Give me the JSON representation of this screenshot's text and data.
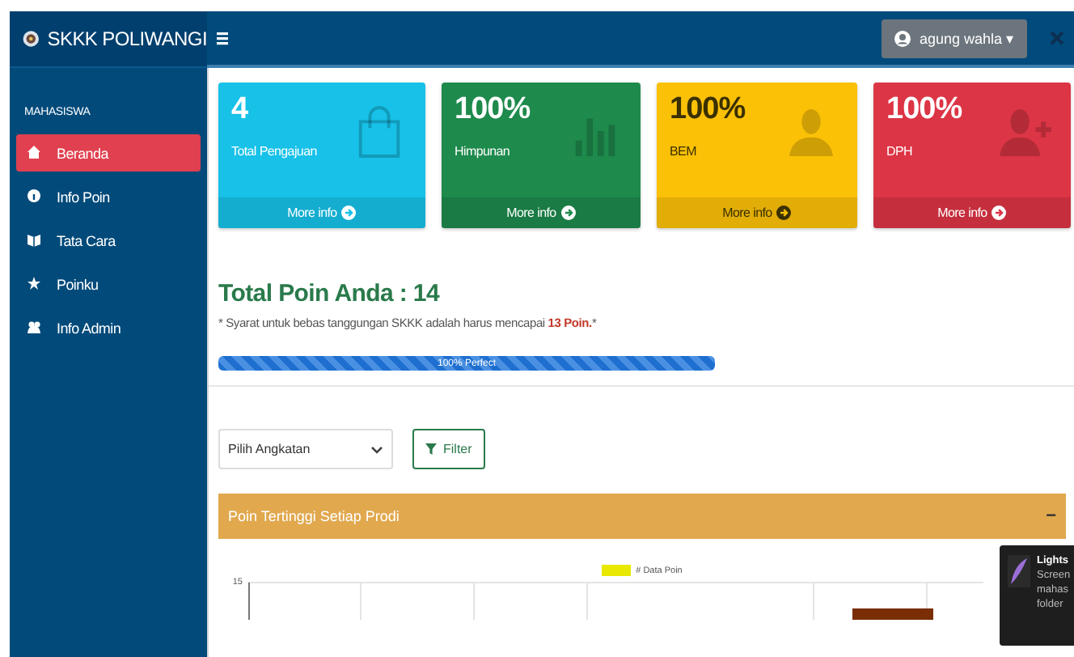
{
  "brand": {
    "title": "SKKK POLIWANGI"
  },
  "user_menu": {
    "name": "agung wahla",
    "caret": "▾"
  },
  "sidebar": {
    "heading": "MAHASISWA",
    "items": [
      {
        "label": "Beranda",
        "selected": true
      },
      {
        "label": "Info Poin",
        "selected": false
      },
      {
        "label": "Tata Cara",
        "selected": false
      },
      {
        "label": "Poinku",
        "selected": false
      },
      {
        "label": "Info Admin",
        "selected": false
      }
    ]
  },
  "cards": [
    {
      "value": "4",
      "label": "Total Pengajuan",
      "link": "More info",
      "color": "#17c1e8"
    },
    {
      "value": "100%",
      "label": "Himpunan",
      "link": "More info",
      "color": "#1e8a4c"
    },
    {
      "value": "100%",
      "label": "BEM",
      "link": "More info",
      "color": "#fbc107"
    },
    {
      "value": "100%",
      "label": "DPH",
      "link": "More info",
      "color": "#dc3545"
    }
  ],
  "summary": {
    "title": "Total Poin Anda : 14",
    "note": "* Syarat untuk bebas tanggungan SKKK adalah harus mencapai **13 Poin.***",
    "progress": {
      "level": 1,
      "label": "100% Perfect"
    }
  },
  "filter": {
    "select": "Pilih Angkatan",
    "button": "Filter"
  },
  "panel": {
    "title": "Poin Tertinggi Setiap Prodi",
    "collapse": "−",
    "legend": "# Data Poin",
    "y_tick": "15"
  },
  "notification": {
    "title": "Lights",
    "lines": [
      "Screen",
      "mahas",
      "folder"
    ]
  }
}
